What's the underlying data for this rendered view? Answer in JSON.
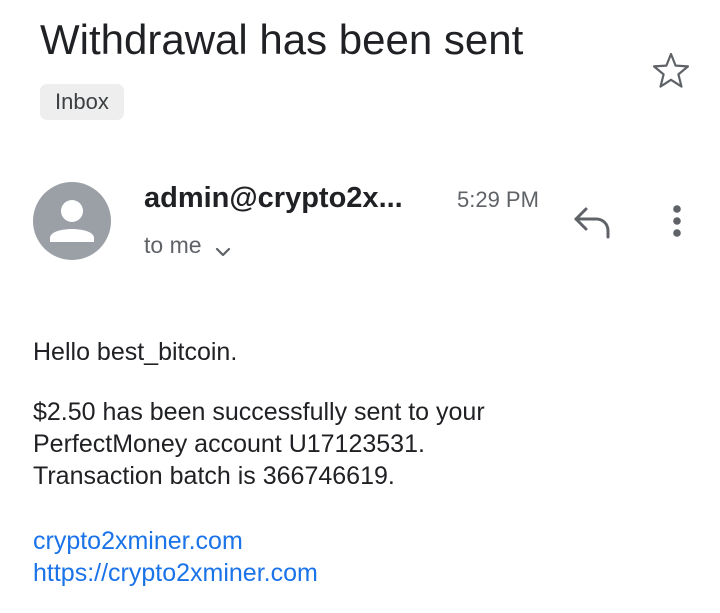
{
  "email": {
    "subject": "Withdrawal has been sent",
    "label": "Inbox",
    "sender": "admin@crypto2x...",
    "time": "5:29 PM",
    "recipient": "to me",
    "body": {
      "greeting": "Hello best_bitcoin.",
      "line1": "$2.50 has been successfully sent to your",
      "line2": "PerfectMoney account U17123531.",
      "line3": "Transaction batch is 366746619.",
      "link1": "crypto2xminer.com",
      "link2": "https://crypto2xminer.com"
    }
  },
  "icons": {
    "star": "star-outline-icon",
    "reply": "reply-icon",
    "more": "more-vert-icon",
    "avatar": "person-avatar-icon",
    "chevron": "chevron-down-icon"
  },
  "colors": {
    "text": "#202124",
    "secondary": "#5f6368",
    "link": "#1a73e8",
    "avatar": "#9aa0a6",
    "chip": "#eeeeee"
  }
}
